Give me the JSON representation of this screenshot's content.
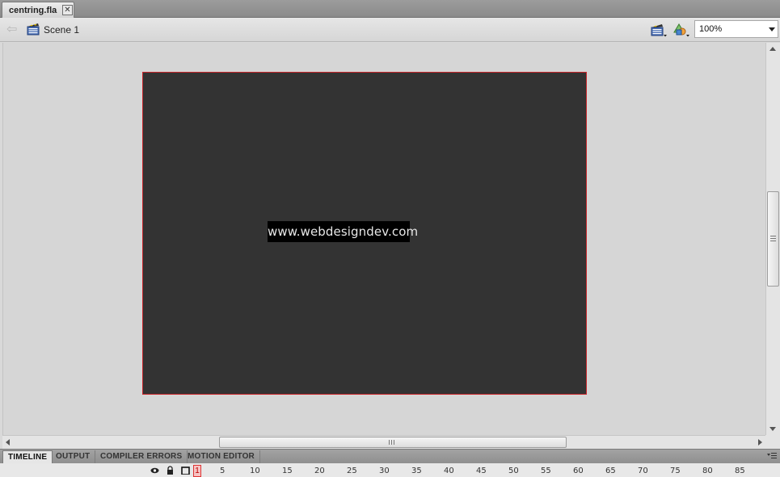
{
  "document_tab": {
    "label": "centring.fla",
    "close_glyph": "✕"
  },
  "edit_bar": {
    "back_glyph": "⇦",
    "scene_label": "Scene 1",
    "zoom_value": "100%"
  },
  "stage": {
    "background_color": "#333333",
    "border_color": "#c8262b",
    "text": "www.webdesigndev.com"
  },
  "panel_tabs": [
    {
      "label": "TIMELINE",
      "active": true
    },
    {
      "label": "OUTPUT",
      "active": false
    },
    {
      "label": "COMPILER ERRORS",
      "active": false
    },
    {
      "label": "MOTION EDITOR",
      "active": false
    }
  ],
  "timeline": {
    "current_frame": "1",
    "frame_numbers": [
      "5",
      "10",
      "15",
      "20",
      "25",
      "30",
      "35",
      "40",
      "45",
      "50",
      "55",
      "60",
      "65",
      "70",
      "75",
      "80",
      "85"
    ]
  },
  "icons": [
    "close-icon",
    "back-arrow-icon",
    "scene-clapper-icon",
    "edit-scene-icon",
    "edit-symbol-icon",
    "dropdown-arrow-icon",
    "eye-icon",
    "lock-icon",
    "outline-icon",
    "panel-menu-icon"
  ]
}
